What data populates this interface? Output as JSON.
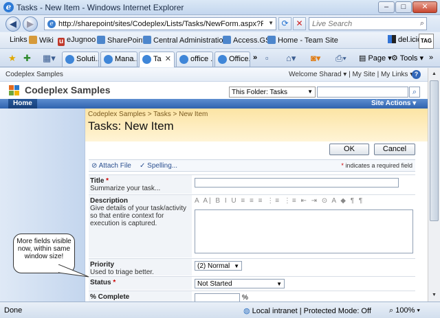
{
  "window": {
    "title": "Tasks - New Item - Windows Internet Explorer",
    "minimize": "–",
    "maximize": "□",
    "close": "✕"
  },
  "addressbar": {
    "url": "http://sharepoint/sites/Codeplex/Lists/Tasks/NewForm.aspx?RootFolder=%",
    "search_placeholder": "Live Search"
  },
  "links": [
    {
      "label": "Links"
    },
    {
      "label": "Wiki"
    },
    {
      "label": "eJugnoo"
    },
    {
      "label": "SharePoint"
    },
    {
      "label": "Central Administration"
    },
    {
      "label": "Access.GS"
    },
    {
      "label": "Home - Team Site"
    }
  ],
  "delicious": "del.icio.us",
  "tag": "TAG",
  "tabs": [
    {
      "label": "Soluti..."
    },
    {
      "label": "Mana..."
    },
    {
      "label": "Ta"
    },
    {
      "label": "office ..."
    },
    {
      "label": "Office..."
    }
  ],
  "more_tabs": "»",
  "commands": {
    "page": "Page",
    "tools": "Tools"
  },
  "sharepoint": {
    "site_crumb": "Codeplex Samples",
    "welcome": "Welcome Sharad ▾  |  My Site  |  My Links ▾  |",
    "site_title": "Codeplex Samples",
    "folder_scope": "This Folder: Tasks",
    "home_tab": "Home",
    "site_actions": "Site Actions ▾",
    "breadcrumb": "Codeplex Samples > Tasks > New Item",
    "page_title": "Tasks: New Item"
  },
  "form": {
    "ok": "OK",
    "cancel": "Cancel",
    "attach": "Attach File",
    "spelling": "Spelling...",
    "required_note": "indicates a required field",
    "title_label": "Title",
    "title_desc": "Summarize your task...",
    "description_label": "Description",
    "description_desc": "Give details of your task/activity so that entire context for execution is captured.",
    "rte_toolbar": "A A| B I U ≡ ≡ ≡ ⋮≡ ⋮≡ ⇤ ⇥ ⊙ A ◆ ¶ ¶",
    "priority_label": "Priority",
    "priority_desc": "Used to triage better.",
    "priority_value": "(2) Normal",
    "status_label": "Status",
    "status_value": "Not Started",
    "percent_label": "% Complete",
    "percent_unit": "%"
  },
  "callout": "More fields visible now, within same window size!",
  "statusbar": {
    "done": "Done",
    "zone": "Local intranet | Protected Mode: Off",
    "zoom": "100%"
  }
}
